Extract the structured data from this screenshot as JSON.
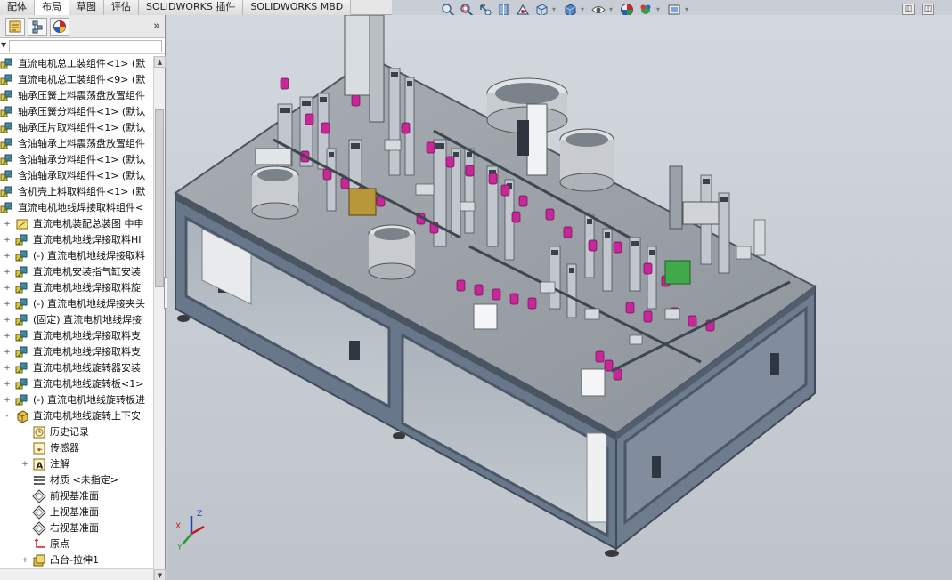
{
  "command_tabs": [
    "配体",
    "布局",
    "草图",
    "评估",
    "SOLIDWORKS 插件",
    "SOLIDWORKS MBD"
  ],
  "active_tab_index": 1,
  "hud_icons": [
    "zoom-to-fit-icon",
    "zoom-area-icon",
    "previous-view-icon",
    "section-view-icon",
    "dynamic-annotation-icon",
    "view-orientation-icon",
    "display-style-icon",
    "hide-show-items-icon",
    "edit-appearance-icon",
    "apply-scene-icon",
    "view-settings-icon"
  ],
  "panel_tab_icons": [
    "feature-manager-icon",
    "configuration-manager-icon",
    "display-manager-icon"
  ],
  "panel_more": "»",
  "filter_arrow": "▼",
  "tree": [
    {
      "label": "直流电机总工装组件<1> (默",
      "indent": 0,
      "expander": "",
      "icon": "assembly"
    },
    {
      "label": "直流电机总工装组件<9> (默",
      "indent": 0,
      "expander": "",
      "icon": "assembly"
    },
    {
      "label": "轴承压簧上料震荡盘放置组件",
      "indent": 0,
      "expander": "",
      "icon": "assembly"
    },
    {
      "label": "轴承压簧分料组件<1> (默认",
      "indent": 0,
      "expander": "",
      "icon": "assembly"
    },
    {
      "label": "轴承压片取料组件<1> (默认",
      "indent": 0,
      "expander": "",
      "icon": "assembly"
    },
    {
      "label": "含油轴承上料震荡盘放置组件",
      "indent": 0,
      "expander": "",
      "icon": "assembly"
    },
    {
      "label": "含油轴承分料组件<1> (默认",
      "indent": 0,
      "expander": "",
      "icon": "assembly"
    },
    {
      "label": "含油轴承取料组件<1> (默认",
      "indent": 0,
      "expander": "",
      "icon": "assembly"
    },
    {
      "label": "含机壳上料取料组件<1> (默",
      "indent": 0,
      "expander": "",
      "icon": "assembly"
    },
    {
      "label": "直流电机地线焊接取料组件<",
      "indent": 0,
      "expander": "",
      "icon": "assembly"
    },
    {
      "label": "直流电机装配总装图 中申",
      "indent": 1,
      "expander": "+",
      "icon": "drawing"
    },
    {
      "label": "直流电机地线焊接取料HI",
      "indent": 1,
      "expander": "+",
      "icon": "assembly"
    },
    {
      "label": "(-) 直流电机地线焊接取料",
      "indent": 1,
      "expander": "+",
      "icon": "assembly"
    },
    {
      "label": "直流电机安装指气缸安装",
      "indent": 1,
      "expander": "+",
      "icon": "assembly"
    },
    {
      "label": "直流电机地线焊接取料旋",
      "indent": 1,
      "expander": "+",
      "icon": "assembly"
    },
    {
      "label": "(-) 直流电机地线焊接夹头",
      "indent": 1,
      "expander": "+",
      "icon": "assembly"
    },
    {
      "label": "(固定) 直流电机地线焊接",
      "indent": 1,
      "expander": "+",
      "icon": "assembly"
    },
    {
      "label": "直流电机地线焊接取料支",
      "indent": 1,
      "expander": "+",
      "icon": "assembly"
    },
    {
      "label": "直流电机地线焊接取料支",
      "indent": 1,
      "expander": "+",
      "icon": "assembly"
    },
    {
      "label": "直流电机地线旋转器安装",
      "indent": 1,
      "expander": "+",
      "icon": "assembly"
    },
    {
      "label": "直流电机地线旋转板<1>",
      "indent": 1,
      "expander": "+",
      "icon": "assembly"
    },
    {
      "label": "(-) 直流电机地线旋转板进",
      "indent": 1,
      "expander": "+",
      "icon": "assembly"
    },
    {
      "label": "直流电机地线旋转上下安",
      "indent": 1,
      "expander": "-",
      "icon": "part"
    },
    {
      "label": "历史记录",
      "indent": 2,
      "expander": "",
      "icon": "history"
    },
    {
      "label": "传感器",
      "indent": 2,
      "expander": "",
      "icon": "sensor"
    },
    {
      "label": "注解",
      "indent": 2,
      "expander": "+",
      "icon": "annotation"
    },
    {
      "label": "材质 <未指定>",
      "indent": 2,
      "expander": "",
      "icon": "material"
    },
    {
      "label": "前视基准面",
      "indent": 2,
      "expander": "",
      "icon": "plane"
    },
    {
      "label": "上视基准面",
      "indent": 2,
      "expander": "",
      "icon": "plane"
    },
    {
      "label": "右视基准面",
      "indent": 2,
      "expander": "",
      "icon": "plane"
    },
    {
      "label": "原点",
      "indent": 2,
      "expander": "",
      "icon": "origin"
    },
    {
      "label": "凸台-拉伸1",
      "indent": 2,
      "expander": "+",
      "icon": "extrude"
    }
  ],
  "triad": {
    "x": "X",
    "y": "Y",
    "z": "Z"
  },
  "colors": {
    "frame": "#5b6a7e",
    "frame_dark": "#3f4b5b",
    "plate": "#9aa0a6",
    "plate_dark": "#7e858c",
    "window": "#b4bcc4",
    "accent_magenta": "#c8279a",
    "accent_green": "#41a94a",
    "bowl": "#c9ccd0",
    "viewport_bg": "#c8cdd4"
  }
}
